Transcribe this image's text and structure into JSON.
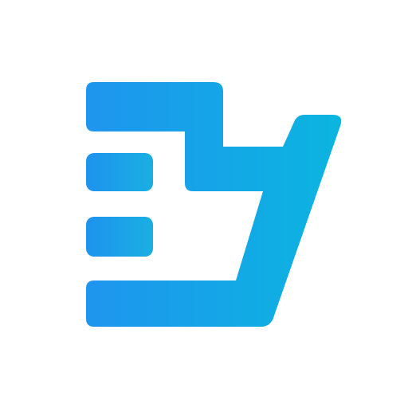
{
  "logo": {
    "icon": "brand-logo-mark",
    "colors": {
      "gradient_start": "#1F95EE",
      "gradient_end": "#0BB5E0",
      "bar_start": "#1E93EE",
      "bar_end": "#1AAFE2",
      "background": "#FFFFFF"
    }
  }
}
